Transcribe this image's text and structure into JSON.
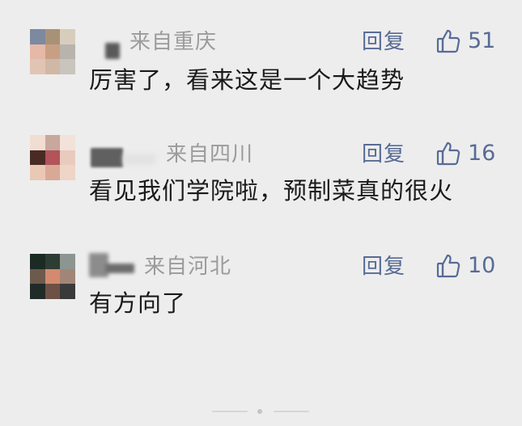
{
  "comments": [
    {
      "location": "来自重庆",
      "reply_label": "回复",
      "like_count": "51",
      "text": "厉害了，看来这是一个大趋势"
    },
    {
      "location": "来自四川",
      "reply_label": "回复",
      "like_count": "16",
      "text": "看见我们学院啦，预制菜真的很火"
    },
    {
      "location": "来自河北",
      "reply_label": "回复",
      "like_count": "10",
      "text": "有方向了"
    }
  ],
  "icons": {
    "like": "thumbs-up-outline-icon"
  },
  "colors": {
    "background": "#ededed",
    "link": "#576b95",
    "meta": "#9b9b9b",
    "text": "#1a1a1a"
  }
}
